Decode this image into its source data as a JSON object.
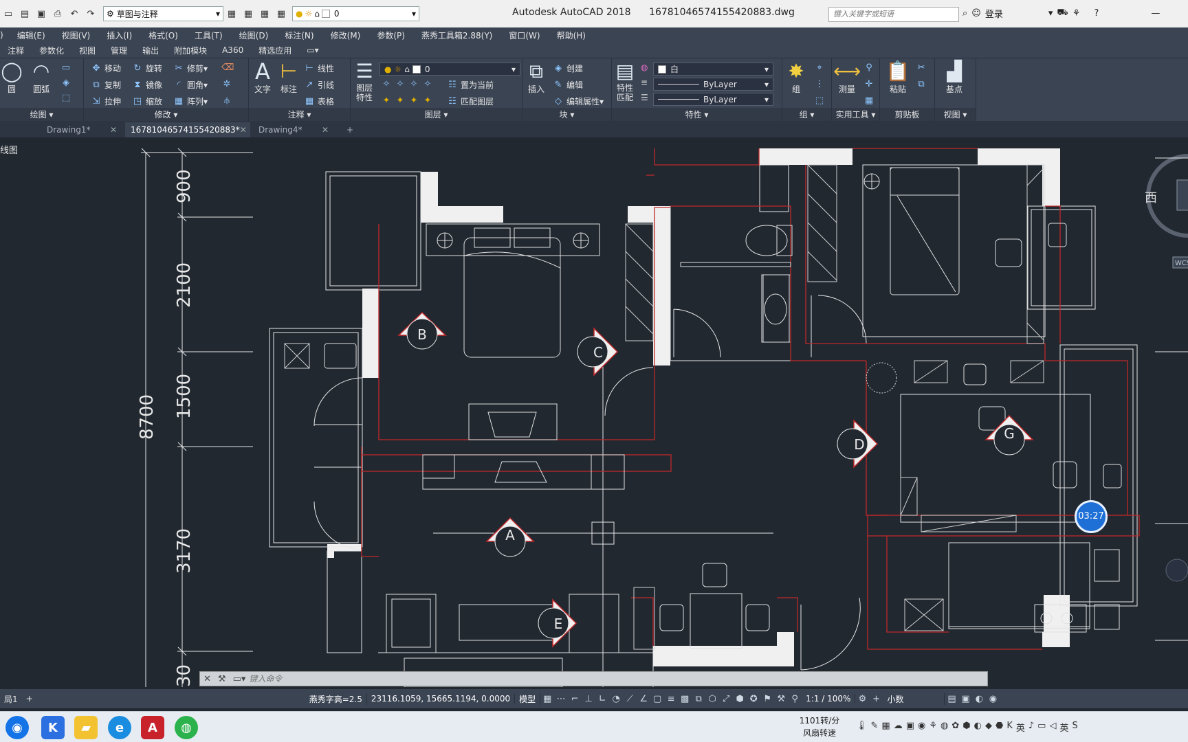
{
  "app": {
    "title": "Autodesk AutoCAD 2018",
    "filename": "16781046574155420883.dwg",
    "workspace": "草图与注释",
    "layer_quick": "0",
    "search_placeholder": "键入关键字或短语",
    "login": "登录"
  },
  "menu": [
    "编辑(E)",
    "视图(V)",
    "插入(I)",
    "格式(O)",
    "工具(T)",
    "绘图(D)",
    "标注(N)",
    "修改(M)",
    "参数(P)",
    "燕秀工具箱2.88(Y)",
    "窗口(W)",
    "帮助(H)"
  ],
  "ribbon_tabs": [
    "注释",
    "参数化",
    "视图",
    "管理",
    "输出",
    "附加模块",
    "A360",
    "精选应用"
  ],
  "ribbon": {
    "draw": {
      "title": "绘图",
      "circle": "圆",
      "arc": "圆弧"
    },
    "modify": {
      "title": "修改",
      "move": "移动",
      "rotate": "旋转",
      "trim": "修剪",
      "copy": "复制",
      "mirror": "镜像",
      "fillet": "圆角",
      "stretch": "拉伸",
      "scale": "缩放",
      "array": "阵列"
    },
    "annotation": {
      "title": "注释",
      "text": "文字",
      "dim": "标注",
      "linear": "线性",
      "leader": "引线",
      "table": "表格"
    },
    "layers": {
      "title": "图层",
      "props": "图层特性",
      "current_layer": "0",
      "set_current": "置为当前",
      "match": "匹配图层"
    },
    "block": {
      "title": "块",
      "insert": "插入",
      "create": "创建",
      "edit": "编辑",
      "edit_attr": "编辑属性"
    },
    "properties": {
      "title": "特性",
      "match": "特性匹配",
      "color": "白",
      "linetype": "ByLayer",
      "lineweight": "ByLayer"
    },
    "groups": {
      "title": "组",
      "group": "组"
    },
    "utilities": {
      "title": "实用工具",
      "measure": "测量"
    },
    "clipboard": {
      "title": "剪贴板",
      "paste": "粘贴"
    },
    "view": {
      "title": "视图",
      "base": "基点"
    }
  },
  "file_tabs": [
    {
      "label": "Drawing1*",
      "active": false
    },
    {
      "label": "16781046574155420883*",
      "active": true
    },
    {
      "label": "Drawing4*",
      "active": false
    }
  ],
  "viewport_label": "线图",
  "dimensions": {
    "total": "8700",
    "segments": [
      "900",
      "2100",
      "1500",
      "3170",
      "30"
    ]
  },
  "view_markers": [
    "B",
    "C",
    "A",
    "E",
    "D",
    "G"
  ],
  "viewcube": {
    "west": "西",
    "wcs": "WCS"
  },
  "timer": "03:27",
  "command": {
    "placeholder": "键入命令"
  },
  "status": {
    "layout": "局1",
    "text_height": "燕秀字高=2.5",
    "coords": "23116.1059, 15665.1194, 0.0000",
    "model": "模型",
    "scale": "1:1 / 100%",
    "units": "小数"
  },
  "taskbar": {
    "fan_speed": "1101转/分",
    "fan_label": "风扇转速",
    "ime": "英"
  },
  "colors": {
    "wall": "#e8e8e8",
    "redline": "#c0282a",
    "background": "#212830",
    "ribbon": "#3b4453"
  }
}
